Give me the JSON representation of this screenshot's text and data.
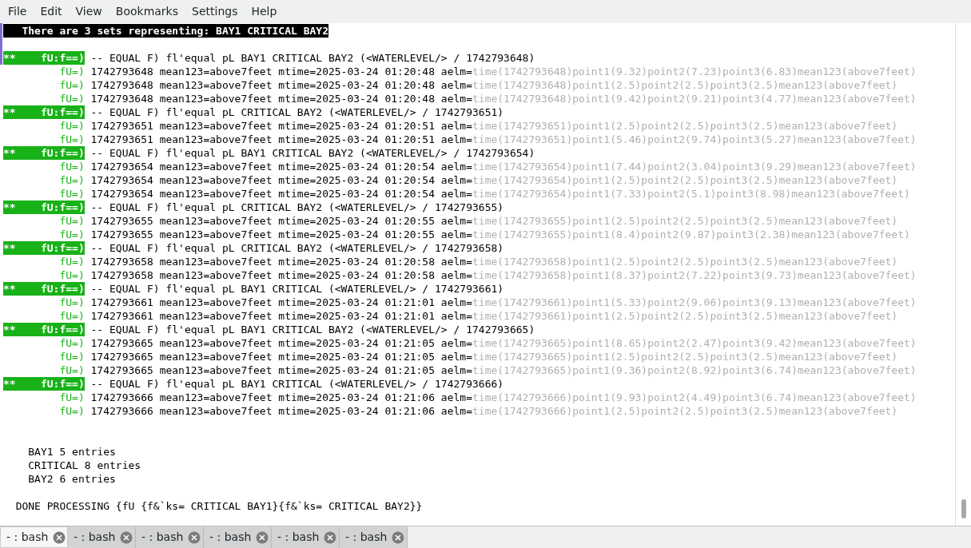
{
  "menu": [
    "File",
    "Edit",
    "View",
    "Bookmarks",
    "Settings",
    "Help"
  ],
  "banner": "There are 3 sets representing: BAY1 CRITICAL BAY2",
  "groups": [
    {
      "marker": "**",
      "tag": "fU:f==)",
      "text": "-- EQUAL F) fl'equal pL BAY1 CRITICAL BAY2 (<WATERLEVEL/> / 1742793648)",
      "entries": [
        {
          "tag": "fU=)",
          "text": "1742793648 mean123=above7feet mtime=2025-03-24 01:20:48 aelm=",
          "detail": "time(1742793648)point1(9.32)point2(7.23)point3(6.83)mean123(above7feet)"
        },
        {
          "tag": "fU=)",
          "text": "1742793648 mean123=above7feet mtime=2025-03-24 01:20:48 aelm=",
          "detail": "time(1742793648)point1(2.5)point2(2.5)point3(2.5)mean123(above7feet)"
        },
        {
          "tag": "fU=)",
          "text": "1742793648 mean123=above7feet mtime=2025-03-24 01:20:48 aelm=",
          "detail": "time(1742793648)point1(9.42)point2(9.21)point3(4.77)mean123(above7feet)"
        }
      ]
    },
    {
      "marker": "**",
      "tag": "fU:f==)",
      "text": "-- EQUAL F) fl'equal pL CRITICAL BAY2 (<WATERLEVEL/> / 1742793651)",
      "entries": [
        {
          "tag": "fU=)",
          "text": "1742793651 mean123=above7feet mtime=2025-03-24 01:20:51 aelm=",
          "detail": "time(1742793651)point1(2.5)point2(2.5)point3(2.5)mean123(above7feet)"
        },
        {
          "tag": "fU=)",
          "text": "1742793651 mean123=above7feet mtime=2025-03-24 01:20:51 aelm=",
          "detail": "time(1742793651)point1(5.46)point2(9.74)point3(5.27)mean123(above7feet)"
        }
      ]
    },
    {
      "marker": "**",
      "tag": "fU:f==)",
      "text": "-- EQUAL F) fl'equal pL BAY1 CRITICAL BAY2 (<WATERLEVEL/> / 1742793654)",
      "entries": [
        {
          "tag": "fU=)",
          "text": "1742793654 mean123=above7feet mtime=2025-03-24 01:20:54 aelm=",
          "detail": "time(1742793654)point1(7.44)point2(3.04)point3(9.29)mean123(above7feet)"
        },
        {
          "tag": "fU=)",
          "text": "1742793654 mean123=above7feet mtime=2025-03-24 01:20:54 aelm=",
          "detail": "time(1742793654)point1(2.5)point2(2.5)point3(2.5)mean123(above7feet)"
        },
        {
          "tag": "fU=)",
          "text": "1742793654 mean123=above7feet mtime=2025-03-24 01:20:54 aelm=",
          "detail": "time(1742793654)point1(7.33)point2(5.1)point3(8.98)mean123(above7feet)"
        }
      ]
    },
    {
      "marker": "**",
      "tag": "fU:f==)",
      "text": "-- EQUAL F) fl'equal pL CRITICAL BAY2 (<WATERLEVEL/> / 1742793655)",
      "entries": [
        {
          "tag": "fU=)",
          "text": "1742793655 mean123=above7feet mtime=2025-03-24 01:20:55 aelm=",
          "detail": "time(1742793655)point1(2.5)point2(2.5)point3(2.5)mean123(above7feet)"
        },
        {
          "tag": "fU=)",
          "text": "1742793655 mean123=above7feet mtime=2025-03-24 01:20:55 aelm=",
          "detail": "time(1742793655)point1(8.4)point2(9.87)point3(2.38)mean123(above7feet)"
        }
      ]
    },
    {
      "marker": "**",
      "tag": "fU:f==)",
      "text": "-- EQUAL F) fl'equal pL CRITICAL BAY2 (<WATERLEVEL/> / 1742793658)",
      "entries": [
        {
          "tag": "fU=)",
          "text": "1742793658 mean123=above7feet mtime=2025-03-24 01:20:58 aelm=",
          "detail": "time(1742793658)point1(2.5)point2(2.5)point3(2.5)mean123(above7feet)"
        },
        {
          "tag": "fU=)",
          "text": "1742793658 mean123=above7feet mtime=2025-03-24 01:20:58 aelm=",
          "detail": "time(1742793658)point1(8.37)point2(7.22)point3(9.73)mean123(above7feet)"
        }
      ]
    },
    {
      "marker": "**",
      "tag": "fU:f==)",
      "text": "-- EQUAL F) fl'equal pL BAY1 CRITICAL (<WATERLEVEL/> / 1742793661)",
      "entries": [
        {
          "tag": "fU=)",
          "text": "1742793661 mean123=above7feet mtime=2025-03-24 01:21:01 aelm=",
          "detail": "time(1742793661)point1(5.33)point2(9.06)point3(9.13)mean123(above7feet)"
        },
        {
          "tag": "fU=)",
          "text": "1742793661 mean123=above7feet mtime=2025-03-24 01:21:01 aelm=",
          "detail": "time(1742793661)point1(2.5)point2(2.5)point3(2.5)mean123(above7feet)"
        }
      ]
    },
    {
      "marker": "**",
      "tag": "fU:f==)",
      "text": "-- EQUAL F) fl'equal pL BAY1 CRITICAL BAY2 (<WATERLEVEL/> / 1742793665)",
      "entries": [
        {
          "tag": "fU=)",
          "text": "1742793665 mean123=above7feet mtime=2025-03-24 01:21:05 aelm=",
          "detail": "time(1742793665)point1(8.65)point2(2.47)point3(9.42)mean123(above7feet)"
        },
        {
          "tag": "fU=)",
          "text": "1742793665 mean123=above7feet mtime=2025-03-24 01:21:05 aelm=",
          "detail": "time(1742793665)point1(2.5)point2(2.5)point3(2.5)mean123(above7feet)"
        },
        {
          "tag": "fU=)",
          "text": "1742793665 mean123=above7feet mtime=2025-03-24 01:21:05 aelm=",
          "detail": "time(1742793665)point1(9.36)point2(8.92)point3(6.74)mean123(above7feet)"
        }
      ]
    },
    {
      "marker": "**",
      "tag": "fU:f==)",
      "text": "-- EQUAL F) fl'equal pL BAY1 CRITICAL (<WATERLEVEL/> / 1742793666)",
      "entries": [
        {
          "tag": "fU=)",
          "text": "1742793666 mean123=above7feet mtime=2025-03-24 01:21:06 aelm=",
          "detail": "time(1742793666)point1(9.93)point2(4.49)point3(6.74)mean123(above7feet)"
        },
        {
          "tag": "fU=)",
          "text": "1742793666 mean123=above7feet mtime=2025-03-24 01:21:06 aelm=",
          "detail": "time(1742793666)point1(2.5)point2(2.5)point3(2.5)mean123(above7feet)"
        }
      ]
    }
  ],
  "summary": [
    "BAY1 5 entries",
    "CRITICAL 8 entries",
    "BAY2 6 entries"
  ],
  "done": "DONE PROCESSING {fU {f&`ks= CRITICAL BAY1}{f&`ks= CRITICAL BAY2}}",
  "tabs": [
    {
      "label": "- : bash",
      "selected": true
    },
    {
      "label": "- : bash",
      "selected": false
    },
    {
      "label": "- : bash",
      "selected": false
    },
    {
      "label": "- : bash",
      "selected": false
    },
    {
      "label": "- : bash",
      "selected": false
    },
    {
      "label": "- : bash",
      "selected": false
    }
  ]
}
